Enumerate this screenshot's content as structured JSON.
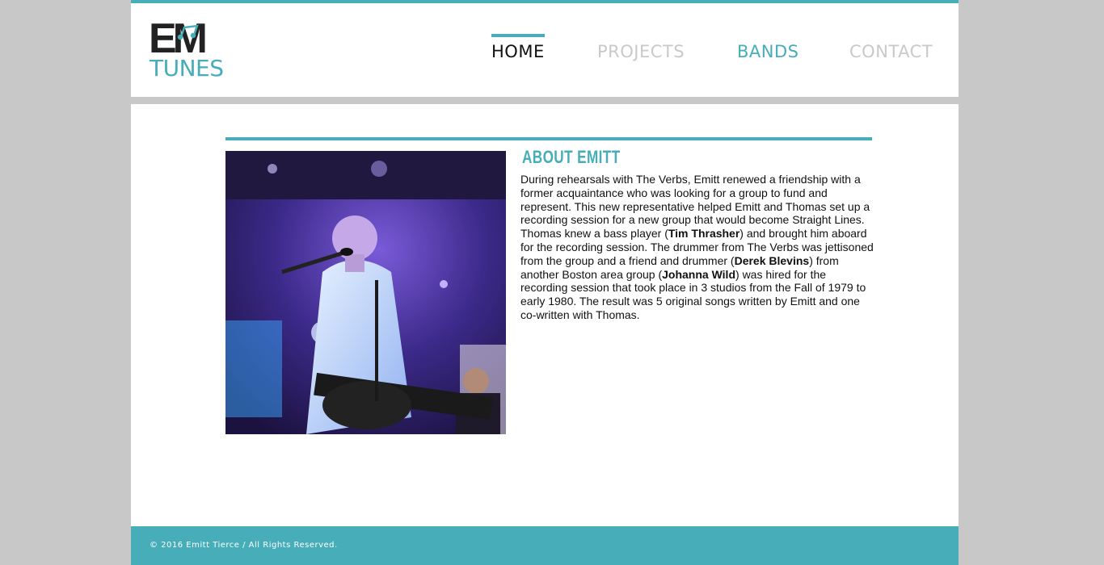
{
  "brand": {
    "logo_top": "EM",
    "logo_bottom": "TUNES",
    "accent_color": "#46adb9"
  },
  "nav": {
    "home": "HOME",
    "projects": "PROJECTS",
    "bands": "BANDS",
    "contact": "CONTACT",
    "active": "HOME"
  },
  "about": {
    "title": "ABOUT EMITT",
    "p1": "During rehearsals with The Verbs, Emitt renewed a friendship with a former acquaintance who was looking for a group to fund and represent. This new representative helped Emitt and Thomas set up a recording session for a new group that would become Straight Lines. Thomas knew a bass player (",
    "name1": "Tim Thrasher",
    "p2": ") and brought him aboard for the recording session. The drummer from The Verbs was jettisoned from the group and a friend and drummer (",
    "name2": "Derek Blevins",
    "p3": ") from another Boston area group (",
    "name3": "Johanna Wild",
    "p4": ") was hired for the recording session that took place in 3 studios from the Fall of 1979 to early 1980. The result was 5 original songs written by Emitt and one co-written with Thomas."
  },
  "footer": {
    "copyright": "© 2016 Emitt Tierce / All Rights Reserved."
  }
}
